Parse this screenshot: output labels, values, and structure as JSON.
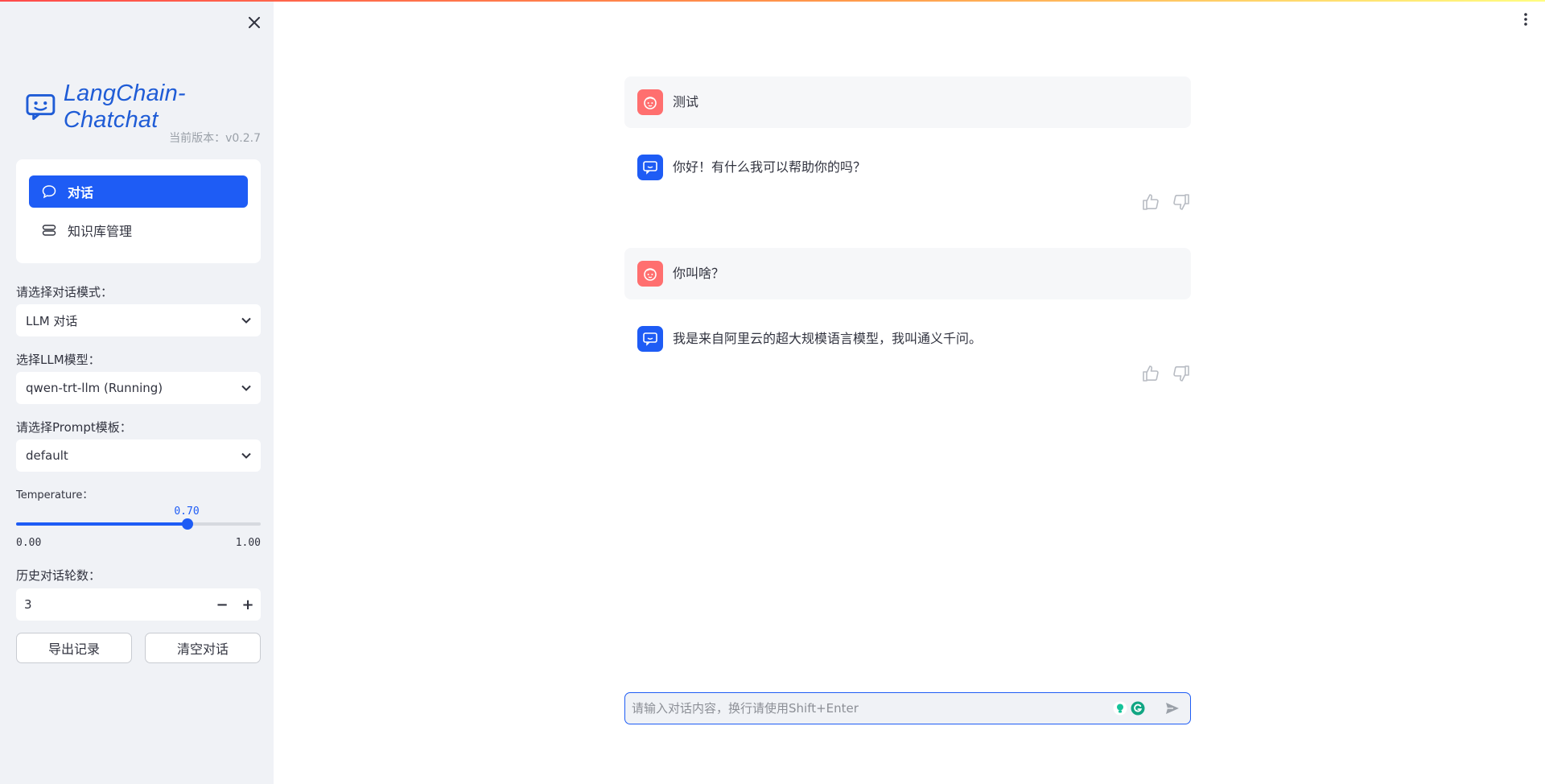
{
  "app": {
    "name": "LangChain-Chatchat"
  },
  "sidebar": {
    "close_icon": "close-icon",
    "version_label": "当前版本：v0.2.7",
    "nav": [
      {
        "label": "对话",
        "icon": "chat-bubble-icon",
        "active": true
      },
      {
        "label": "知识库管理",
        "icon": "database-icon",
        "active": false
      }
    ],
    "mode": {
      "label": "请选择对话模式：",
      "value": "LLM 对话"
    },
    "model": {
      "label": "选择LLM模型：",
      "value": "qwen-trt-llm (Running)"
    },
    "prompt": {
      "label": "请选择Prompt模板：",
      "value": "default"
    },
    "temperature": {
      "label": "Temperature：",
      "value": 0.7,
      "value_text": "0.70",
      "min_text": "0.00",
      "max_text": "1.00"
    },
    "history": {
      "label": "历史对话轮数：",
      "value": "3",
      "minus": "−",
      "plus": "+"
    },
    "export_label": "导出记录",
    "clear_label": "清空对话"
  },
  "chat": {
    "messages": [
      {
        "role": "user",
        "text": "测试"
      },
      {
        "role": "assistant",
        "text": "你好！有什么我可以帮助你的吗？"
      },
      {
        "role": "user",
        "text": "你叫啥？"
      },
      {
        "role": "assistant",
        "text": "我是来自阿里云的超大规模语言模型，我叫通义千问。"
      }
    ],
    "input_placeholder": "请输入对话内容，换行请使用Shift+Enter"
  },
  "colors": {
    "accent": "#1e5cf5",
    "user_avatar": "#ff6f6f",
    "sidebar_bg": "#f0f2f6",
    "user_bubble_bg": "#f6f7f9"
  }
}
